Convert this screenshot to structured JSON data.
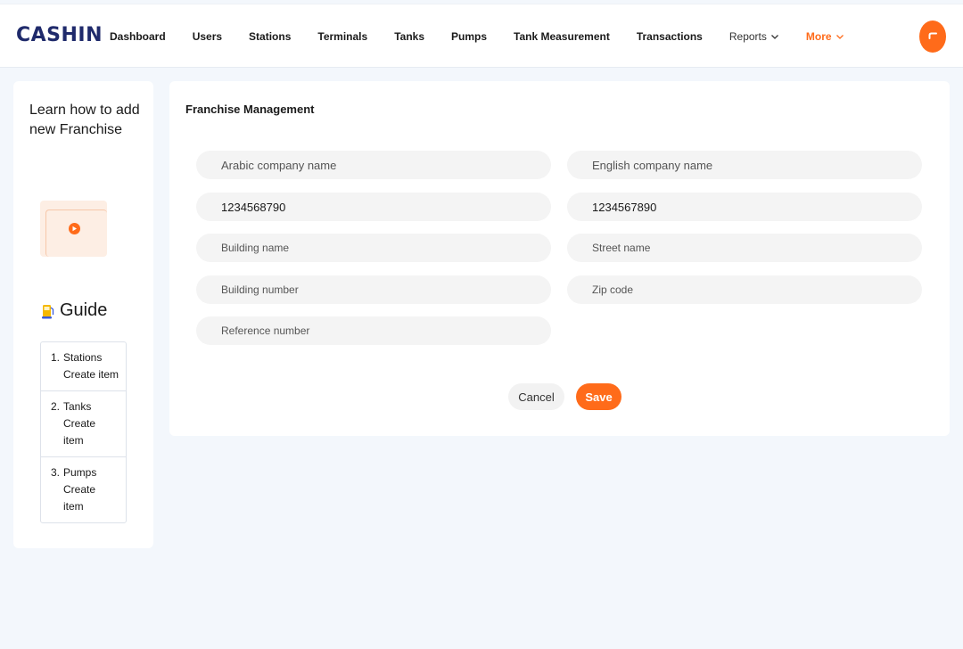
{
  "header": {
    "logo_text": "CASHIN",
    "nav": [
      {
        "label": "Dashboard"
      },
      {
        "label": "Users"
      },
      {
        "label": "Stations"
      },
      {
        "label": "Terminals"
      },
      {
        "label": "Tanks"
      },
      {
        "label": "Pumps"
      },
      {
        "label": "Tank Measurement"
      },
      {
        "label": "Transactions"
      },
      {
        "label": "Reports"
      },
      {
        "label": "More"
      }
    ],
    "accent_color": "#ff6b1a",
    "brand_color": "#1f2a6b"
  },
  "sidebar": {
    "title": "Learn how to add new Franchise",
    "video_icon": "play-icon",
    "guide_icon": "fuel-pump-icon",
    "guide_title": "Guide",
    "guide_items": [
      {
        "num": "1.",
        "title": "Stations",
        "action": "Create item"
      },
      {
        "num": "2.",
        "title": "Tanks",
        "action": "Create item"
      },
      {
        "num": "3.",
        "title": "Pumps",
        "action": "Create item"
      }
    ]
  },
  "form": {
    "title": "Franchise Management",
    "arabic_name": {
      "value": "",
      "placeholder": "Arabic company name"
    },
    "english_name": {
      "value": "",
      "placeholder": "English company name"
    },
    "phone_1": {
      "value": "1234568790",
      "placeholder": ""
    },
    "phone_2": {
      "value": "1234567890",
      "placeholder": ""
    },
    "building_name": {
      "value": "",
      "placeholder": "Building name"
    },
    "street_name": {
      "value": "",
      "placeholder": "Street name"
    },
    "building_number": {
      "value": "",
      "placeholder": "Building number"
    },
    "zip_code": {
      "value": "",
      "placeholder": "Zip code"
    },
    "reference_number": {
      "value": "",
      "placeholder": "Reference number"
    },
    "cancel_label": "Cancel",
    "save_label": "Save"
  }
}
